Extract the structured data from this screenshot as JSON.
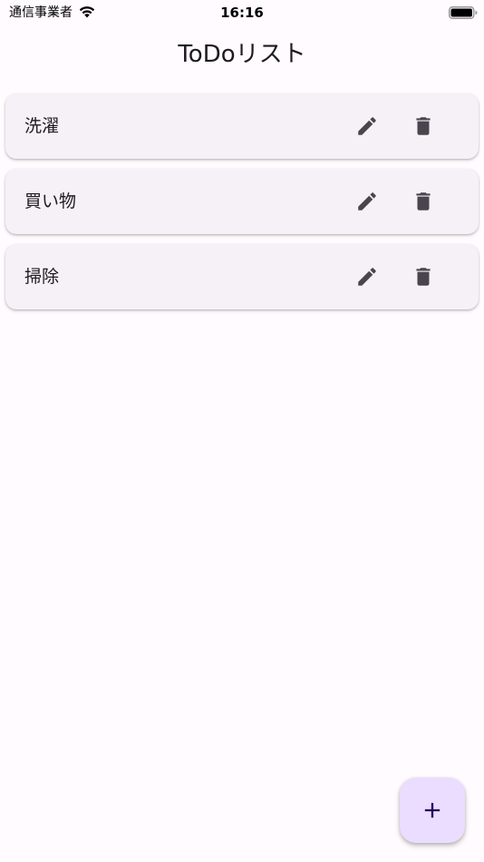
{
  "status_bar": {
    "carrier": "通信事業者",
    "time": "16:16",
    "wifi_icon": "wifi-icon",
    "battery_icon": "battery-icon"
  },
  "app_bar": {
    "title": "ToDoリスト"
  },
  "todos": [
    {
      "title": "洗濯",
      "edit_icon": "pencil-icon",
      "delete_icon": "trash-icon"
    },
    {
      "title": "買い物",
      "edit_icon": "pencil-icon",
      "delete_icon": "trash-icon"
    },
    {
      "title": "掃除",
      "edit_icon": "pencil-icon",
      "delete_icon": "trash-icon"
    }
  ],
  "fab": {
    "icon": "plus-icon"
  },
  "colors": {
    "background": "#fffbfe",
    "card": "#f5f1f6",
    "icon": "#49454f",
    "fab_background": "#eaddff",
    "fab_icon": "#21005d"
  }
}
